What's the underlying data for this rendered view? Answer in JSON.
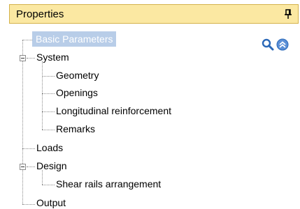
{
  "panel": {
    "title": "Properties",
    "pin_icon": "pin-icon"
  },
  "toolbar": {
    "search_icon": "search-icon",
    "collapse_icon": "collapse-up-icon"
  },
  "tree": {
    "basic_parameters": "Basic Parameters",
    "system": "System",
    "system_children": [
      "Geometry",
      "Openings",
      "Longitudinal reinforcement",
      "Remarks"
    ],
    "loads": "Loads",
    "design": "Design",
    "design_children": [
      "Shear rails arrangement"
    ],
    "output": "Output"
  },
  "colors": {
    "title_bg": "#fbe8a2",
    "title_border": "#d4b24c",
    "selection_bg": "#b8cde8",
    "accent_blue": "#2a68b8"
  }
}
